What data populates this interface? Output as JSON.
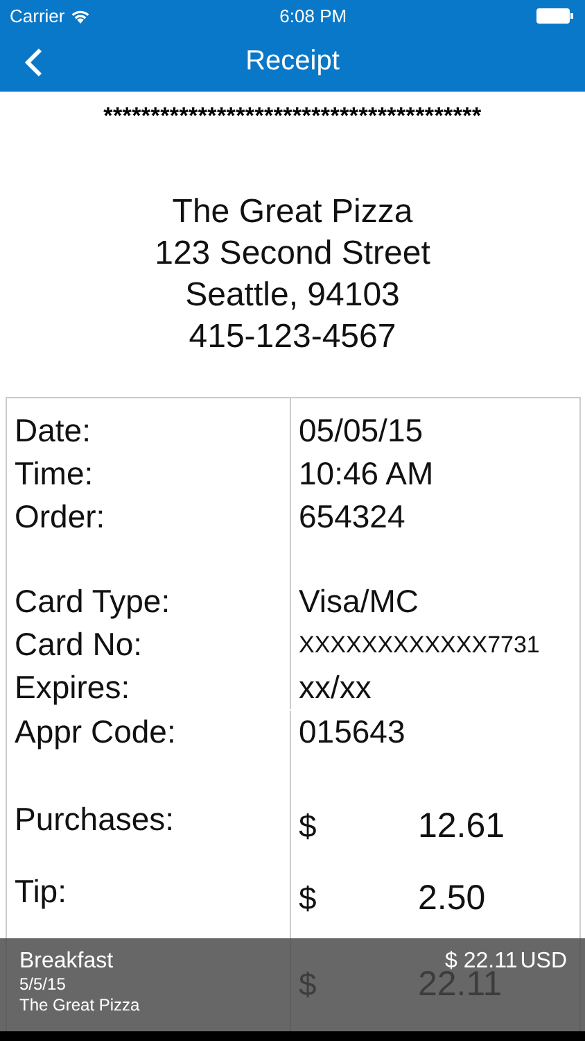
{
  "status_bar": {
    "carrier": "Carrier",
    "time": "6:08 PM"
  },
  "nav": {
    "title": "Receipt"
  },
  "receipt": {
    "stars": "****************************************",
    "address": [
      "The Great Pizza",
      "123 Second Street",
      "Seattle, 94103",
      "415-123-4567"
    ],
    "groups": [
      {
        "fields": [
          {
            "label": "Date:",
            "value": "05/05/15"
          },
          {
            "label": "Time:",
            "value": "10:46 AM"
          },
          {
            "label": "Order:",
            "value": "654324"
          }
        ]
      },
      {
        "fields": [
          {
            "label": "Card Type:",
            "value": "Visa/MC"
          },
          {
            "label": "Card No:",
            "value": "XXXXXXXXXXXX7731"
          },
          {
            "label": "Expires:",
            "value": "xx/xx"
          },
          {
            "label": "Appr Code:",
            "value": "015643"
          }
        ]
      }
    ],
    "amounts": [
      {
        "label": "Purchases:",
        "currency": "$",
        "amount": "12.61"
      },
      {
        "label": "Tip:",
        "currency": "$",
        "amount": "2.50"
      },
      {
        "currency": "$",
        "amount": "22.11"
      }
    ]
  },
  "summary": {
    "title": "Breakfast",
    "amount": "$ 22.11",
    "currency": "USD",
    "date": "5/5/15",
    "merchant": "The Great Pizza"
  }
}
